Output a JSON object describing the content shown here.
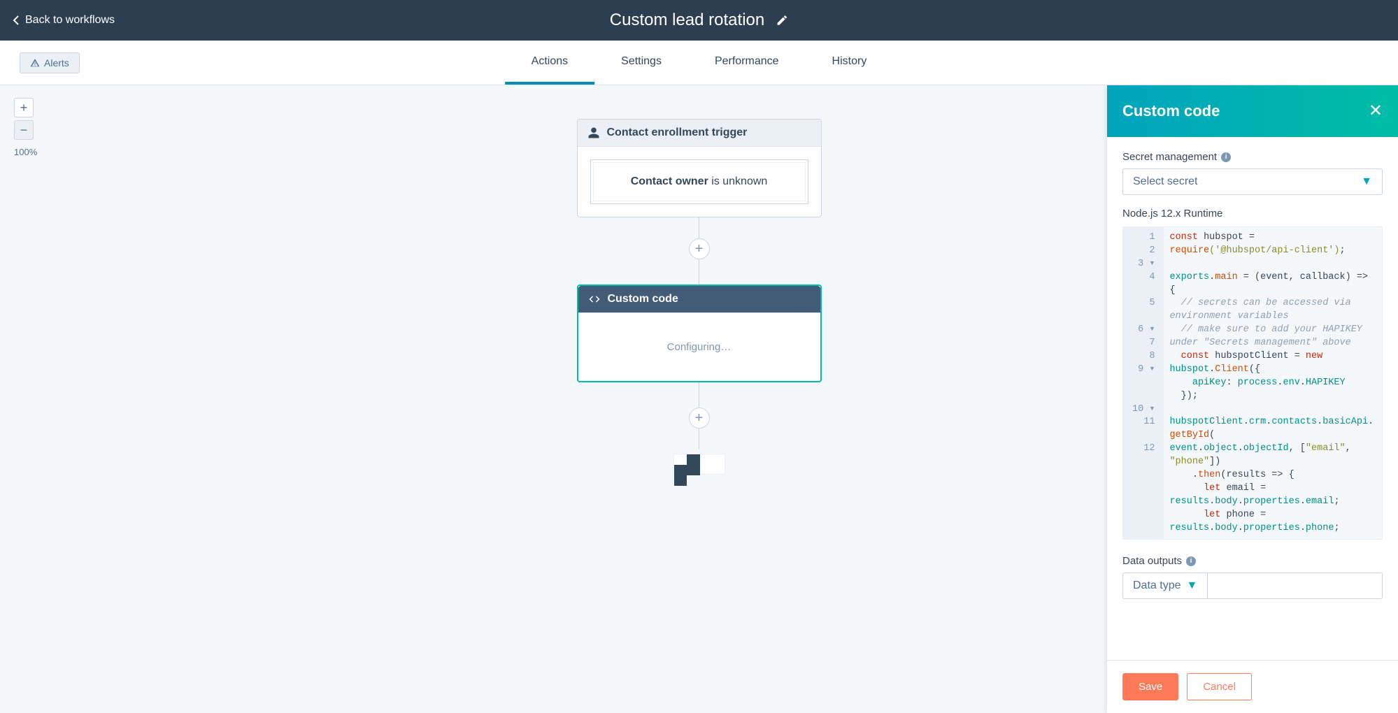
{
  "header": {
    "back_label": "Back to workflows",
    "title": "Custom lead rotation"
  },
  "subheader": {
    "alerts_label": "Alerts",
    "tabs": [
      {
        "label": "Actions",
        "active": true
      },
      {
        "label": "Settings",
        "active": false
      },
      {
        "label": "Performance",
        "active": false
      },
      {
        "label": "History",
        "active": false
      }
    ]
  },
  "zoom": {
    "level": "100%"
  },
  "canvas": {
    "trigger": {
      "header": "Contact enrollment trigger",
      "condition_label": "Contact owner",
      "condition_text": " is unknown"
    },
    "custom_code": {
      "header": "Custom code",
      "body": "Configuring…"
    }
  },
  "panel": {
    "title": "Custom code",
    "secret_label": "Secret management",
    "secret_placeholder": "Select secret",
    "runtime_label": "Node.js 12.x Runtime",
    "data_outputs_label": "Data outputs",
    "data_type_label": "Data type",
    "save_label": "Save",
    "cancel_label": "Cancel",
    "code_lines": [
      {
        "num": "1",
        "fold": ""
      },
      {
        "num": "2",
        "fold": ""
      },
      {
        "num": "3",
        "fold": "▾"
      },
      {
        "num": "4",
        "fold": ""
      },
      {
        "num": "5",
        "fold": ""
      },
      {
        "num": "6",
        "fold": "▾"
      },
      {
        "num": "7",
        "fold": ""
      },
      {
        "num": "8",
        "fold": ""
      },
      {
        "num": "9",
        "fold": "▾"
      },
      {
        "num": "10",
        "fold": "▾"
      },
      {
        "num": "11",
        "fold": ""
      },
      {
        "num": "12",
        "fold": ""
      }
    ],
    "code_text": {
      "l1_kw": "const",
      "l1_var": " hubspot = ",
      "l1_req": "require",
      "l1_str": "('@hubspot/api-client')",
      "l1_end": ";",
      "l3_exp": "exports",
      "l3_dot": ".",
      "l3_main": "main",
      "l3_rest": " = (event, callback) => {",
      "l4_com": "  // secrets can be accessed via environment variables",
      "l5_com": "  // make sure to add your HAPIKEY under \"Secrets management\" above",
      "l6_kw": "  const",
      "l6_var": " hubspotClient = ",
      "l6_new": "new",
      "l6_sp": " ",
      "l6_hs": "hubspot",
      "l6_dot": ".",
      "l6_client": "Client",
      "l6_paren": "({",
      "l7_key": "    apiKey",
      "l7_colon": ": ",
      "l7_proc": "process",
      "l7_dot1": ".",
      "l7_env": "env",
      "l7_dot2": ".",
      "l7_hapi": "HAPIKEY",
      "l8_close": "  });",
      "l9a": "hubspotClient",
      "l9b": ".",
      "l9c": "crm",
      "l9d": ".",
      "l9e": "contacts",
      "l9f": ".",
      "l9g": "basicApi",
      "l9h": ".",
      "l9i": "getById",
      "l9j": "(",
      "l9_2a": "event",
      "l9_2b": ".",
      "l9_2c": "object",
      "l9_2d": ".",
      "l9_2e": "objectId",
      "l9_2f": ", [",
      "l9_2g": "\"email\"",
      "l9_2h": ", ",
      "l9_2i": "\"phone\"",
      "l9_2j": "])",
      "l10a": "    .",
      "l10b": "then",
      "l10c": "(results => {",
      "l11_let": "      let",
      "l11_var": " email = ",
      "l11_res": "results",
      "l11_d1": ".",
      "l11_body": "body",
      "l11_d2": ".",
      "l11_props": "properties",
      "l11_d3": ".",
      "l11_email": "email",
      "l11_end": ";",
      "l12_let": "      let",
      "l12_var": " phone = ",
      "l12_res": "results",
      "l12_d1": ".",
      "l12_body": "body",
      "l12_d2": ".",
      "l12_props": "properties",
      "l12_d3": ".",
      "l12_phone": "phone",
      "l12_end": ";"
    }
  }
}
